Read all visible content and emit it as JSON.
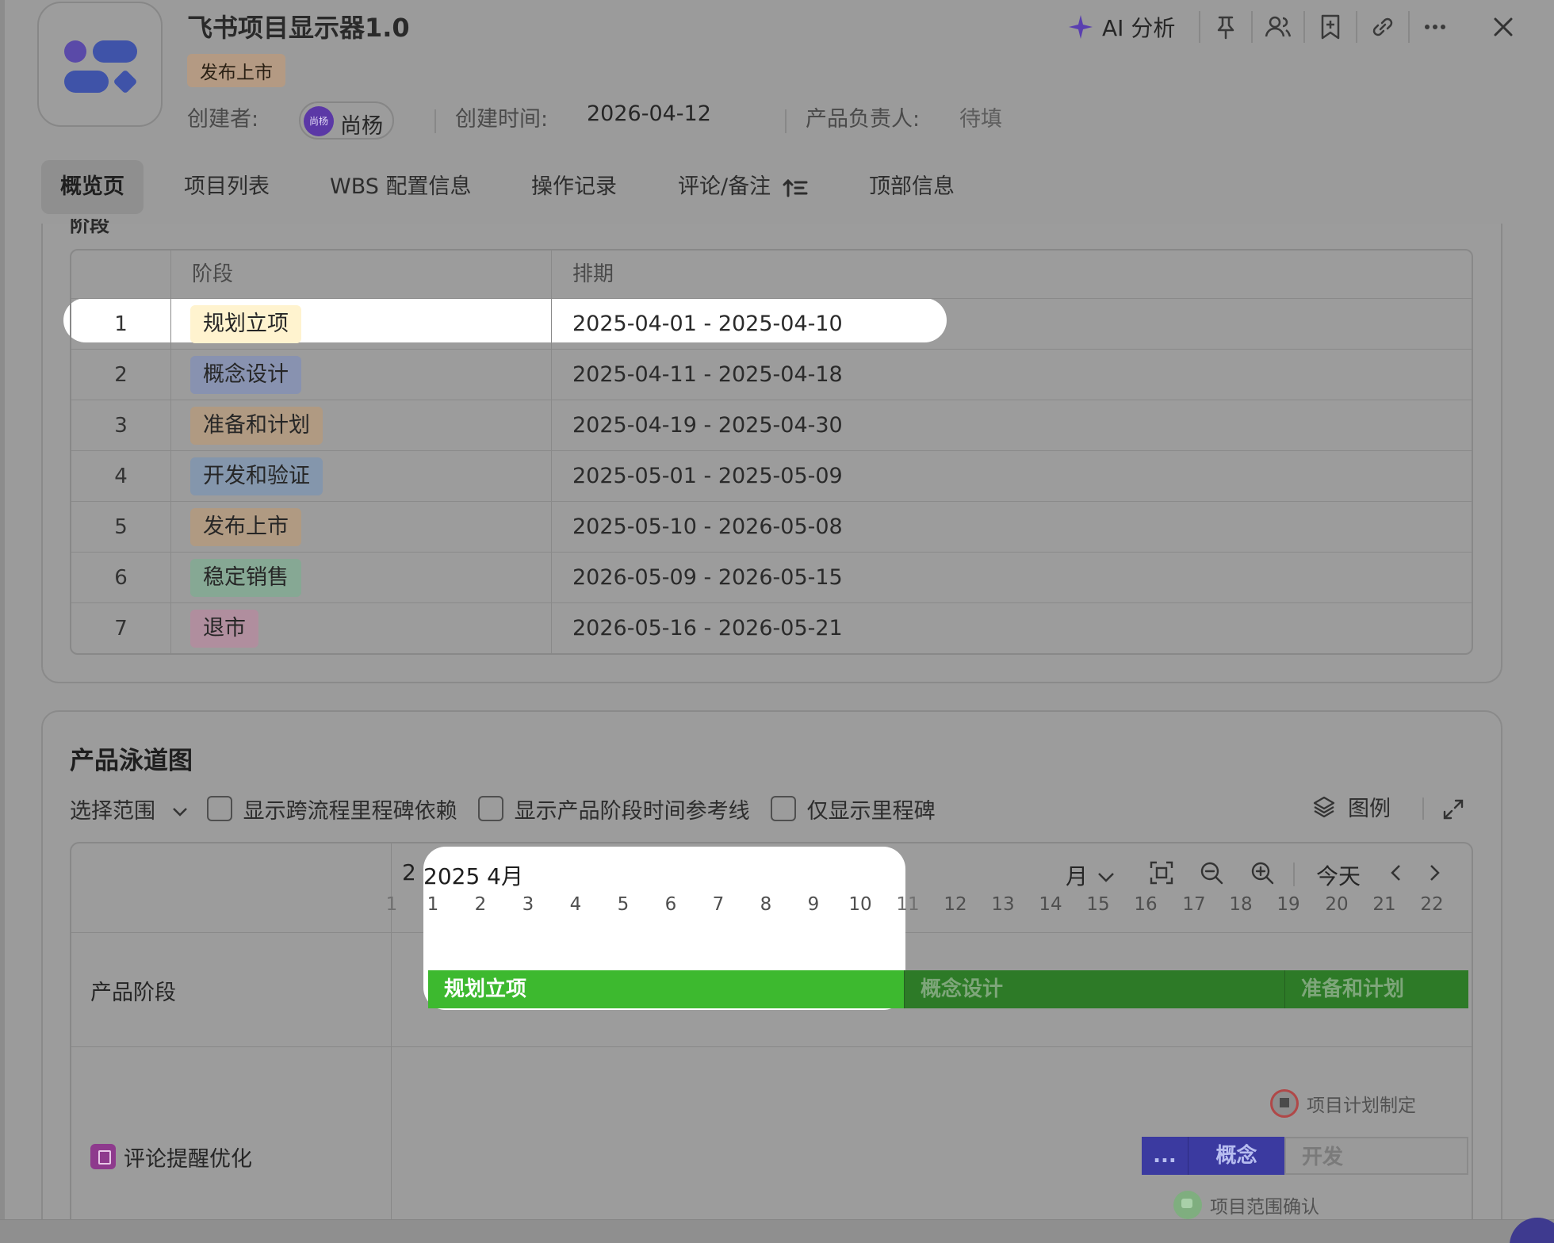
{
  "header": {
    "title": "飞书项目显示器1.0",
    "stage_tag": "发布上市",
    "creator_label": "创建者:",
    "creator_avatar_text": "尚杨",
    "creator_name": "尚杨",
    "created_time_label": "创建时间:",
    "created_time": "2026-04-12",
    "owner_label": "产品负责人:",
    "owner_value": "待填"
  },
  "actions": {
    "ai_label": "AI 分析",
    "icons": [
      "pin-icon",
      "members-icon",
      "bookmark-icon",
      "link-icon",
      "more-icon",
      "close-icon"
    ]
  },
  "tabs": [
    {
      "label": "概览页",
      "active": true
    },
    {
      "label": "项目列表"
    },
    {
      "label": "WBS 配置信息"
    },
    {
      "label": "操作记录"
    },
    {
      "label": "评论/备注"
    },
    {
      "label": "顶部信息"
    }
  ],
  "stages": {
    "clipped_heading": "阶段",
    "columns": [
      "阶段",
      "排期"
    ],
    "rows": [
      {
        "index": "1",
        "stage": "规划立项",
        "schedule": "2025-04-01 - 2025-04-10",
        "color": "#fff3cf"
      },
      {
        "index": "2",
        "stage": "概念设计",
        "schedule": "2025-04-11 - 2025-04-18",
        "color": "#8892b0"
      },
      {
        "index": "3",
        "stage": "准备和计划",
        "schedule": "2025-04-19 - 2025-04-30",
        "color": "#b09a82"
      },
      {
        "index": "4",
        "stage": "开发和验证",
        "schedule": "2025-05-01 - 2025-05-09",
        "color": "#8496ac"
      },
      {
        "index": "5",
        "stage": "发布上市",
        "schedule": "2025-05-10 - 2026-05-08",
        "color": "#b09a82"
      },
      {
        "index": "6",
        "stage": "稳定销售",
        "schedule": "2026-05-09 - 2026-05-15",
        "color": "#86a894"
      },
      {
        "index": "7",
        "stage": "退市",
        "schedule": "2026-05-16 - 2026-05-21",
        "color": "#b08e9e"
      }
    ]
  },
  "roadmap": {
    "title": "产品泳道图",
    "range_label": "选择范围",
    "filters": [
      "显示跨流程里程碑依赖",
      "显示产品阶段时间参考线",
      "仅显示里程碑"
    ],
    "legend_label": "图例",
    "month_cut": "2",
    "month_label": "2025 4月",
    "view_mode": "月",
    "today_label": "今天",
    "days": [
      "1",
      "1",
      "2",
      "3",
      "4",
      "5",
      "6",
      "7",
      "8",
      "9",
      "10",
      "11",
      "12",
      "13",
      "14",
      "15",
      "16",
      "17",
      "18",
      "19",
      "20",
      "21",
      "22"
    ],
    "lane_stage_label": "产品阶段",
    "stage_bars": [
      {
        "label": "规划立项",
        "color": "#3db92f"
      },
      {
        "label": "概念设计",
        "color": "#2d7a27"
      },
      {
        "label": "准备和计划",
        "color": "#2d7a27"
      }
    ],
    "lane2_label": "评论提醒优化",
    "milestone1": "项目计划制定",
    "milestone2": "项目范围确认",
    "mini_bars": [
      {
        "label": "...",
        "color": "#3b3aa0"
      },
      {
        "label": "概念",
        "color": "#3b3aa0"
      },
      {
        "label": "开发",
        "color": "#9a9a9a"
      }
    ]
  }
}
